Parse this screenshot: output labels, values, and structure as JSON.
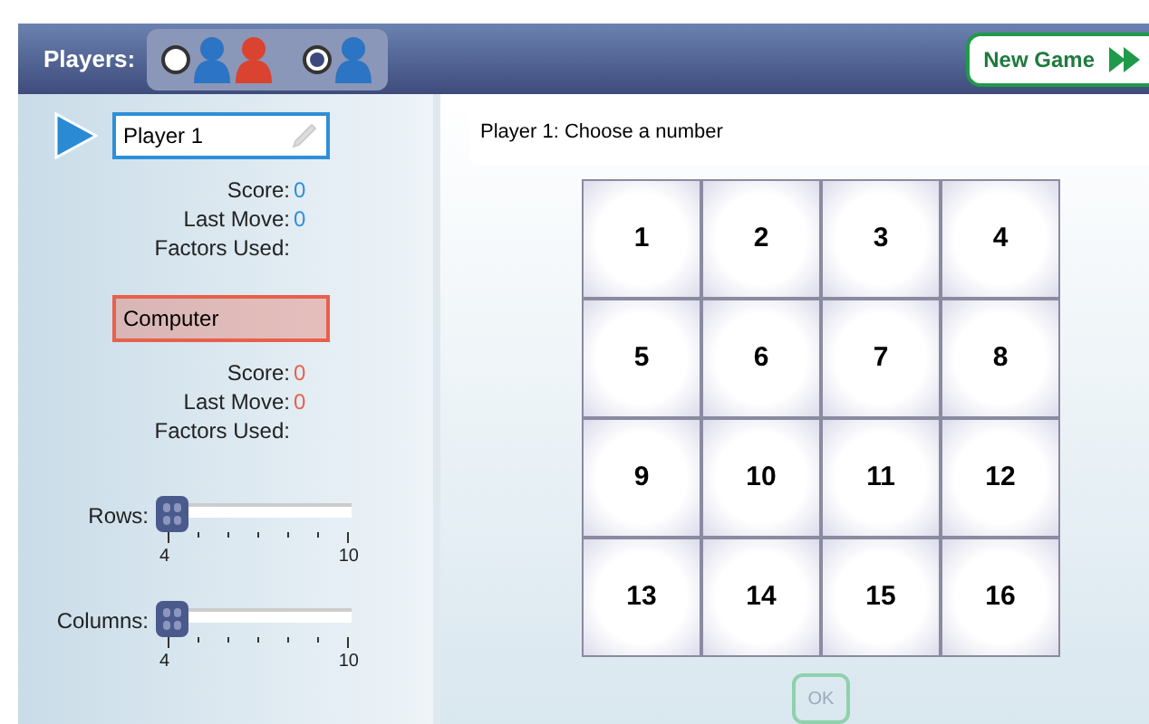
{
  "header": {
    "label": "Players:",
    "modes": [
      {
        "kind": "versus",
        "selected": false
      },
      {
        "kind": "solo",
        "selected": true
      }
    ],
    "new_game": "New Game"
  },
  "players": [
    {
      "name": "Player 1",
      "active": true,
      "editable": true,
      "color": "#2f8fd8",
      "score_label": "Score:",
      "score": "0",
      "last_move_label": "Last Move:",
      "last_move": "0",
      "factors_label": "Factors Used:"
    },
    {
      "name": "Computer",
      "active": false,
      "editable": false,
      "color": "#e8604c",
      "score_label": "Score:",
      "score": "0",
      "last_move_label": "Last Move:",
      "last_move": "0",
      "factors_label": "Factors Used:"
    }
  ],
  "sliders": [
    {
      "label": "Rows:",
      "level": 0,
      "min": "4",
      "max": "10"
    },
    {
      "label": "Columns:",
      "level": 0,
      "min": "4",
      "max": "10"
    }
  ],
  "prompt": "Player 1: Choose a number",
  "grid": [
    {
      "cells": [
        "1",
        "2",
        "3",
        "4"
      ]
    },
    {
      "cells": [
        "5",
        "6",
        "7",
        "8"
      ]
    },
    {
      "cells": [
        "9",
        "10",
        "11",
        "12"
      ]
    },
    {
      "cells": [
        "13",
        "14",
        "15",
        "16"
      ]
    }
  ],
  "ok": {
    "label": "OK",
    "disabled": true
  }
}
